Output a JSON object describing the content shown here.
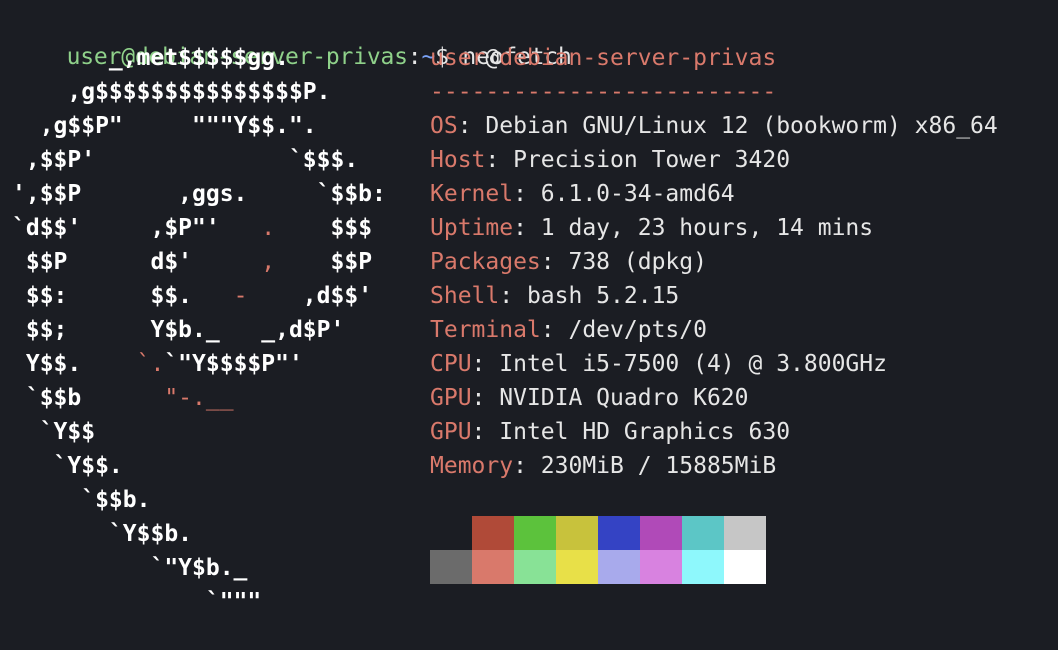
{
  "prompt": {
    "user": "user",
    "at": "@",
    "host": "debian-server-privas",
    "sep": ":",
    "path": "~",
    "dollar": "$",
    "command": "neofetch"
  },
  "logo": {
    "rows": [
      [
        {
          "t": "       _,met$$$$$gg.",
          "c": "w"
        }
      ],
      [
        {
          "t": "    ,g$$$$$$$$$$$$$$$P.",
          "c": "w"
        }
      ],
      [
        {
          "t": "  ,g$$P\"     \"\"\"Y$$.\".",
          "c": "w"
        }
      ],
      [
        {
          "t": " ,$$P'              `$$$.",
          "c": "w"
        }
      ],
      [
        {
          "t": "',$$P       ,ggs.     `$$b:",
          "c": "w"
        }
      ],
      [
        {
          "t": "`d$$'     ,$P\"'   ",
          "c": "w"
        },
        {
          "t": ".",
          "c": "r"
        },
        {
          "t": "    $$$",
          "c": "w"
        }
      ],
      [
        {
          "t": " $$P      d$'     ",
          "c": "w"
        },
        {
          "t": ",",
          "c": "r"
        },
        {
          "t": "    $$P",
          "c": "w"
        }
      ],
      [
        {
          "t": " $$:      $$.   ",
          "c": "w"
        },
        {
          "t": "-",
          "c": "r"
        },
        {
          "t": "    ,d$$'",
          "c": "w"
        }
      ],
      [
        {
          "t": " $$;      Y$b._   _,d$P'",
          "c": "w"
        }
      ],
      [
        {
          "t": " Y$$.    ",
          "c": "w"
        },
        {
          "t": "`.",
          "c": "r"
        },
        {
          "t": "`\"Y$$$$P\"'",
          "c": "w"
        }
      ],
      [
        {
          "t": " `$$b      ",
          "c": "w"
        },
        {
          "t": "\"-.__",
          "c": "r"
        }
      ],
      [
        {
          "t": "  `Y$$",
          "c": "w"
        }
      ],
      [
        {
          "t": "   `Y$$.",
          "c": "w"
        }
      ],
      [
        {
          "t": "     `$$b.",
          "c": "w"
        }
      ],
      [
        {
          "t": "       `Y$$b.",
          "c": "w"
        }
      ],
      [
        {
          "t": "          `\"Y$b._",
          "c": "w"
        }
      ],
      [
        {
          "t": "              `\"\"\"",
          "c": "w"
        }
      ]
    ]
  },
  "info": {
    "title_user": "user",
    "title_at": "@",
    "title_host": "debian-server-privas",
    "underline": "-------------------------",
    "items": [
      {
        "key": "OS",
        "value": "Debian GNU/Linux 12 (bookworm) x86_64"
      },
      {
        "key": "Host",
        "value": "Precision Tower 3420"
      },
      {
        "key": "Kernel",
        "value": "6.1.0-34-amd64"
      },
      {
        "key": "Uptime",
        "value": "1 day, 23 hours, 14 mins"
      },
      {
        "key": "Packages",
        "value": "738 (dpkg)"
      },
      {
        "key": "Shell",
        "value": "bash 5.2.15"
      },
      {
        "key": "Terminal",
        "value": "/dev/pts/0"
      },
      {
        "key": "CPU",
        "value": "Intel i5-7500 (4) @ 3.800GHz"
      },
      {
        "key": "GPU",
        "value": "NVIDIA Quadro K620"
      },
      {
        "key": "GPU",
        "value": "Intel HD Graphics 630"
      },
      {
        "key": "Memory",
        "value": "230MiB / 15885MiB"
      }
    ]
  },
  "colors": {
    "background": "#1b1d23",
    "accent": "#d9796b",
    "prompt_green": "#8fd18a",
    "palette_top": [
      "#1b1d23",
      "#b04a38",
      "#5cc23c",
      "#c8c23c",
      "#3443c4",
      "#b04ab8",
      "#5cc6c6",
      "#c6c6c6"
    ],
    "palette_bottom": [
      "#6b6b6b",
      "#d9796b",
      "#88e296",
      "#e8e048",
      "#a8aaec",
      "#d882e0",
      "#8ef8fc",
      "#ffffff"
    ]
  }
}
